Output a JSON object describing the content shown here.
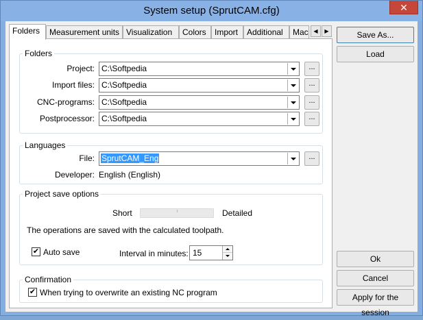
{
  "window": {
    "title": "System setup (SprutCAM.cfg)",
    "close_glyph": "✕"
  },
  "tabs": [
    {
      "label": "Folders",
      "active": true
    },
    {
      "label": "Measurement units"
    },
    {
      "label": "Visualization"
    },
    {
      "label": "Colors"
    },
    {
      "label": "Import"
    },
    {
      "label": "Additional"
    },
    {
      "label": "Mac"
    }
  ],
  "tab_scroll": {
    "left": "◀",
    "right": "▶"
  },
  "folders": {
    "title": "Folders",
    "rows": [
      {
        "label": "Project:",
        "value": "C:\\Softpedia"
      },
      {
        "label": "Import files:",
        "value": "C:\\Softpedia"
      },
      {
        "label": "CNC-programs:",
        "value": "C:\\Softpedia"
      },
      {
        "label": "Postprocessor:",
        "value": "C:\\Softpedia"
      }
    ],
    "browse_label": "..."
  },
  "languages": {
    "title": "Languages",
    "file_label": "File:",
    "file_value": "SprutCAM_Eng",
    "developer_label": "Developer:",
    "developer_value": "English (English)"
  },
  "save_options": {
    "title": "Project save options",
    "slider_min": "Short",
    "slider_max": "Detailed",
    "description": "The operations are saved with the calculated toolpath.",
    "autosave_label": "Auto save",
    "autosave_checked": true,
    "interval_label": "Interval in minutes:",
    "interval_value": "15"
  },
  "confirmation": {
    "title": "Confirmation",
    "overwrite_label": "When trying to overwrite an existing NC program",
    "overwrite_checked": true
  },
  "buttons": {
    "save_as": "Save As...",
    "load": "Load",
    "ok": "Ok",
    "cancel": "Cancel",
    "apply": "Apply for the session"
  },
  "check_glyph": "✔"
}
